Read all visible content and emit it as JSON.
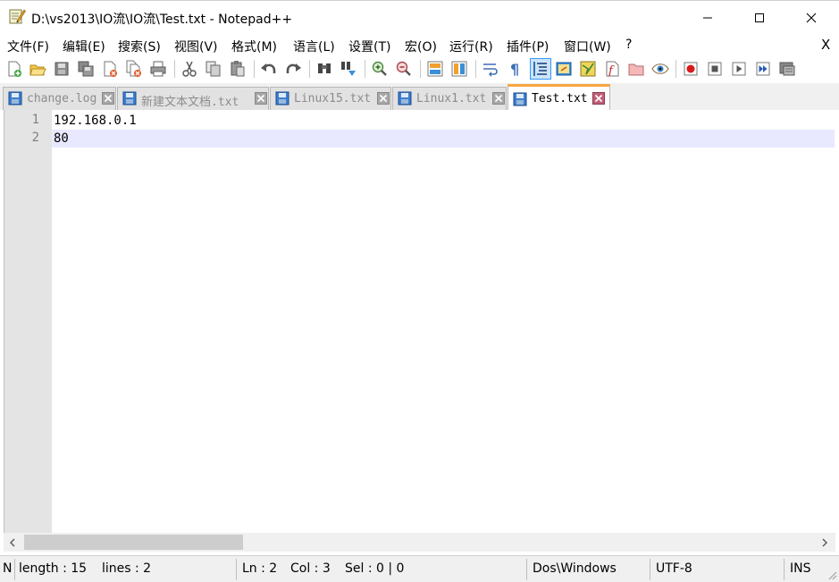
{
  "window": {
    "title": "D:\\vs2013\\IO流\\IO流\\Test.txt - Notepad++",
    "minimize_glyph": "—",
    "maximize_glyph": "☐",
    "close_glyph": "✕"
  },
  "menu": {
    "items": [
      "文件(F)",
      "编辑(E)",
      "搜索(S)",
      "视图(V)",
      "格式(M)",
      "语言(L)",
      "设置(T)",
      "宏(O)",
      "运行(R)",
      "插件(P)",
      "窗口(W)",
      "?"
    ],
    "close_doc": "X"
  },
  "toolbar": {
    "icons": [
      "new-file-icon",
      "open-file-icon",
      "save-icon",
      "save-all-icon",
      "close-icon",
      "close-all-icon",
      "print-icon",
      "cut-icon",
      "copy-icon",
      "paste-icon",
      "undo-icon",
      "redo-icon",
      "find-icon",
      "replace-icon",
      "zoom-in-icon",
      "zoom-out-icon",
      "sync-vertical-icon",
      "sync-horizontal-icon",
      "word-wrap-icon",
      "show-all-chars-icon",
      "indent-guide-icon",
      "udl-icon",
      "doc-map-icon",
      "function-list-icon",
      "folder-workspace-icon",
      "monitoring-icon",
      "record-macro-icon",
      "stop-record-icon",
      "play-macro-icon",
      "run-macro-multiple-icon",
      "save-macro-icon"
    ]
  },
  "tabs": [
    {
      "label": "change.log",
      "active": false
    },
    {
      "label": "新建文本文档.txt",
      "active": false
    },
    {
      "label": "Linux15.txt",
      "active": false
    },
    {
      "label": "Linux1.txt",
      "active": false
    },
    {
      "label": "Test.txt",
      "active": true
    }
  ],
  "editor": {
    "lines": [
      {
        "number": "1",
        "text": "192.168.0.1"
      },
      {
        "number": "2",
        "text": "80"
      }
    ],
    "current_line": 2
  },
  "statusbar": {
    "file_type": "N",
    "length": "length : 15",
    "lines": "lines : 2",
    "ln": "Ln : 2",
    "col": "Col : 3",
    "sel": "Sel : 0 | 0",
    "eol": "Dos\\Windows",
    "encoding": "UTF-8",
    "mode": "INS"
  },
  "colors": {
    "active_tab_accent": "#f9a640",
    "current_line": "#e8e8ff",
    "gutter": "#e4e4e4"
  }
}
